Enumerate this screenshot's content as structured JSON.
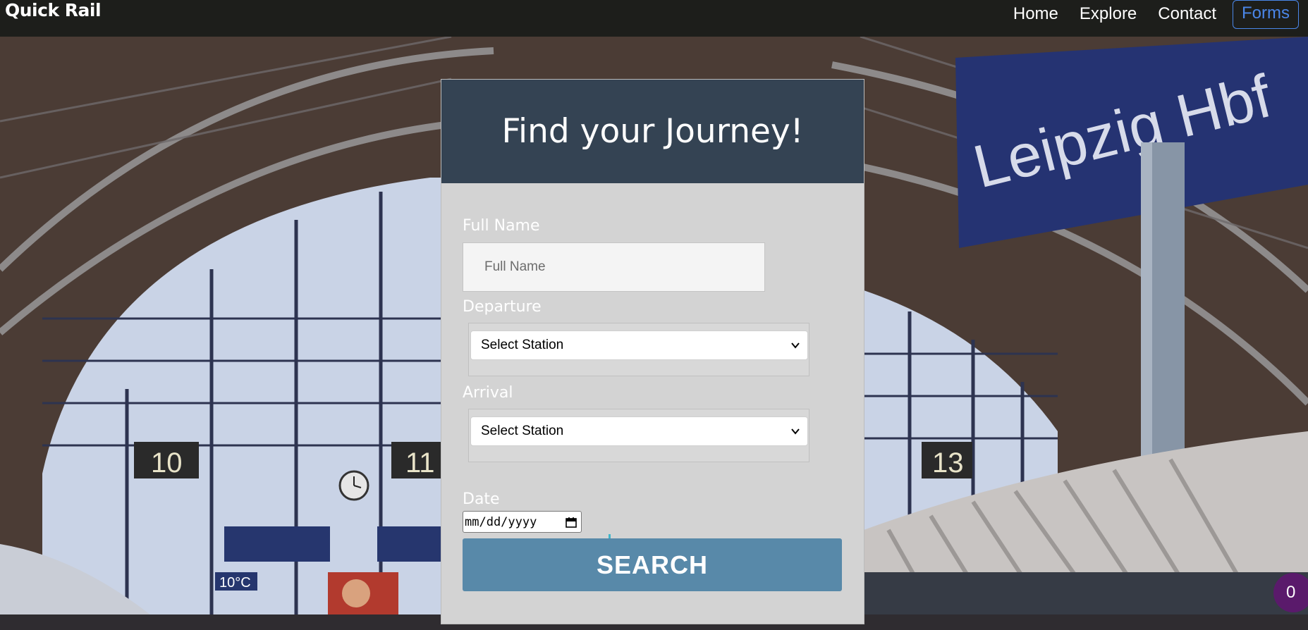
{
  "navbar": {
    "brand": "Quick Rail",
    "links": [
      {
        "label": "Home",
        "active": false
      },
      {
        "label": "Explore",
        "active": false
      },
      {
        "label": "Contact",
        "active": false
      },
      {
        "label": "Forms",
        "active": true
      }
    ]
  },
  "background": {
    "station_sign": "Leipzig Hbf",
    "platform_numbers": [
      "10",
      "11",
      "13"
    ],
    "temperature": "10°C"
  },
  "form": {
    "title": "Find your Journey!",
    "full_name": {
      "label": "Full Name",
      "placeholder": "Full Name",
      "value": ""
    },
    "departure": {
      "label": "Departure",
      "selected": "Select Station"
    },
    "arrival": {
      "label": "Arrival",
      "selected": "Select Station"
    },
    "date": {
      "label": "Date",
      "placeholder": "mm/dd/yyyy"
    },
    "submit_label": "SEARCH"
  },
  "badge": {
    "count": "0"
  },
  "colors": {
    "navbar_bg": "#1d1e1b",
    "active_link": "#4a86e8",
    "card_header": "#344353",
    "card_body": "#d3d3d3",
    "search_button": "#5889a9",
    "badge": "#5a1a6b"
  }
}
